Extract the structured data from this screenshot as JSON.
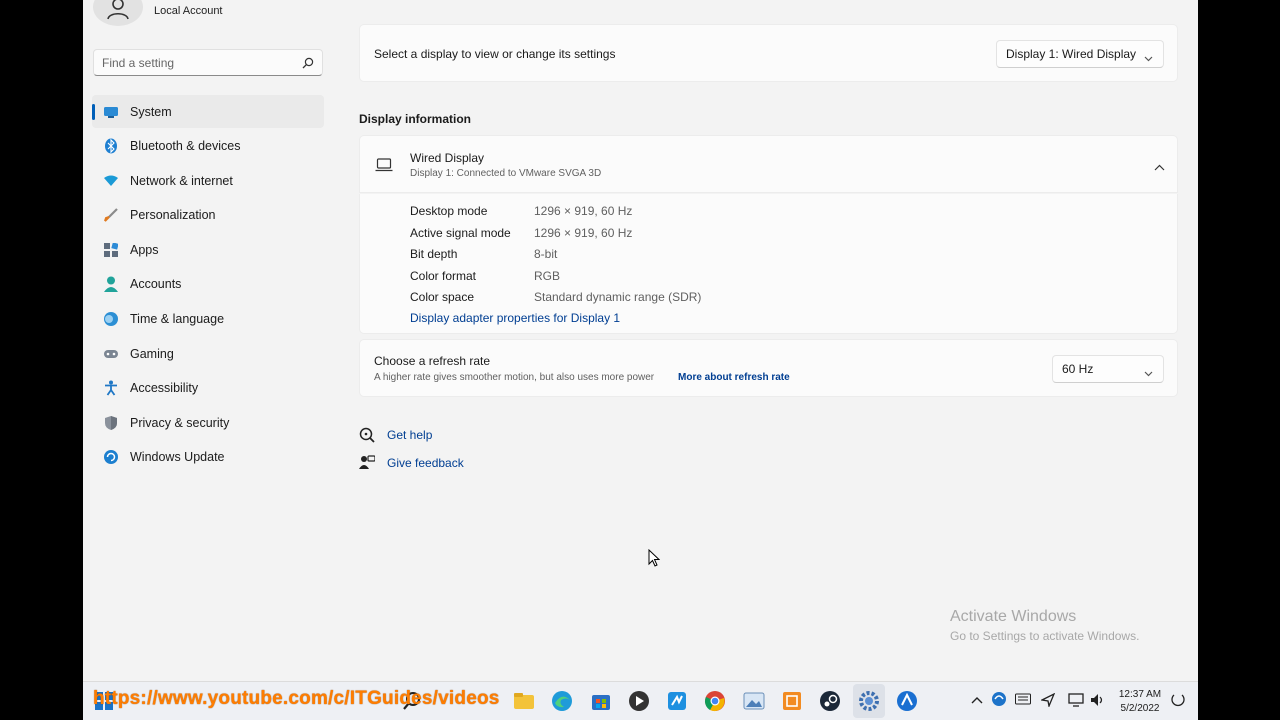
{
  "account": {
    "label": "Local Account"
  },
  "search": {
    "placeholder": "Find a setting"
  },
  "sidebar": {
    "items": [
      {
        "label": "System",
        "icon": "monitor-icon",
        "active": true
      },
      {
        "label": "Bluetooth & devices",
        "icon": "bluetooth-icon"
      },
      {
        "label": "Network & internet",
        "icon": "wifi-icon"
      },
      {
        "label": "Personalization",
        "icon": "paintbrush-icon"
      },
      {
        "label": "Apps",
        "icon": "apps-icon"
      },
      {
        "label": "Accounts",
        "icon": "person-icon"
      },
      {
        "label": "Time & language",
        "icon": "globe-clock-icon"
      },
      {
        "label": "Gaming",
        "icon": "gamepad-icon"
      },
      {
        "label": "Accessibility",
        "icon": "accessibility-icon"
      },
      {
        "label": "Privacy & security",
        "icon": "shield-icon"
      },
      {
        "label": "Windows Update",
        "icon": "update-icon"
      }
    ]
  },
  "main": {
    "select_display": {
      "label": "Select a display to view or change its settings",
      "value": "Display 1: Wired Display"
    },
    "section_title": "Display information",
    "display": {
      "name": "Wired Display",
      "subtitle": "Display 1: Connected to VMware SVGA 3D",
      "info": [
        {
          "key": "Desktop mode",
          "value": "1296 × 919, 60 Hz"
        },
        {
          "key": "Active signal mode",
          "value": "1296 × 919, 60 Hz"
        },
        {
          "key": "Bit depth",
          "value": "8-bit"
        },
        {
          "key": "Color format",
          "value": "RGB"
        },
        {
          "key": "Color space",
          "value": "Standard dynamic range (SDR)"
        }
      ],
      "adapter_link": "Display adapter properties for Display 1"
    },
    "refresh": {
      "label": "Choose a refresh rate",
      "description": "A higher rate gives smoother motion, but also uses more power",
      "more_link": "More about refresh rate",
      "value": "60 Hz"
    },
    "help": {
      "get_help": "Get help",
      "give_feedback": "Give feedback"
    }
  },
  "watermark": {
    "title": "Activate Windows",
    "subtitle": "Go to Settings to activate Windows."
  },
  "taskbar": {
    "overlay_url": "https://www.youtube.com/c/ITGuides/videos",
    "clock_time": "12:37 AM",
    "clock_date": "5/2/2022"
  },
  "colors": {
    "accent": "#005fb8",
    "link": "#003e92",
    "background": "#f3f3f3",
    "overlay": "#ff7d00"
  }
}
